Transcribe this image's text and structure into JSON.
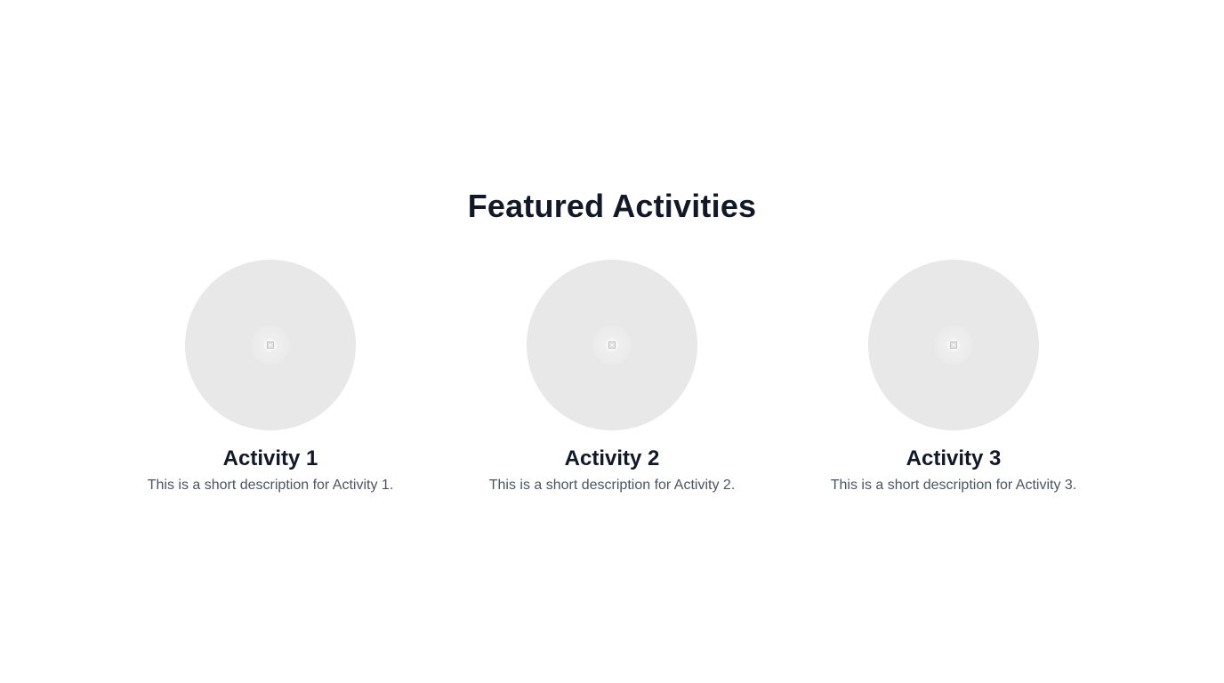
{
  "section": {
    "title": "Featured Activities"
  },
  "activities": [
    {
      "title": "Activity 1",
      "description": "This is a short description for Activity 1.",
      "image_icon": "image-placeholder-icon"
    },
    {
      "title": "Activity 2",
      "description": "This is a short description for Activity 2.",
      "image_icon": "image-placeholder-icon"
    },
    {
      "title": "Activity 3",
      "description": "This is a short description for Activity 3.",
      "image_icon": "image-placeholder-icon"
    }
  ],
  "colors": {
    "background": "#ffffff",
    "heading": "#111827",
    "body_text": "#4b5563",
    "placeholder_fill": "#e8e8e8"
  }
}
